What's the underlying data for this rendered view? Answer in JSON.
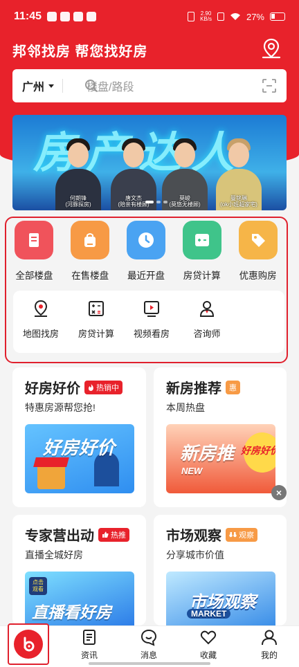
{
  "status_bar": {
    "time": "11:45",
    "net_speed_top": "2.90",
    "net_speed_unit": "KB/s",
    "battery": "27%"
  },
  "header": {
    "title": "邦邻找房 帮您找好房",
    "location_icon": "location-pin-icon"
  },
  "search": {
    "city": "广州",
    "placeholder": "楼盘/路段"
  },
  "banner": {
    "title": "房产达人",
    "people": [
      {
        "name": "何朗锋",
        "desc": "(河豚探房)"
      },
      {
        "name": "唐文杰",
        "desc": "(陪亲有楼顾)"
      },
      {
        "name": "莫峻",
        "desc": "(莫悠无楼顾)"
      },
      {
        "name": "曼铭琳",
        "desc": "(ok小班超家宅)"
      }
    ]
  },
  "categories": [
    {
      "label": "全部楼盘",
      "icon": "building-icon",
      "color": "#f0535b"
    },
    {
      "label": "在售楼盘",
      "icon": "bag-icon",
      "color": "#f79a45"
    },
    {
      "label": "最近开盘",
      "icon": "clock-icon",
      "color": "#4aa3f2"
    },
    {
      "label": "房贷计算",
      "icon": "calculator-icon",
      "color": "#3fc48a"
    },
    {
      "label": "优惠购房",
      "icon": "coupon-tag-icon",
      "color": "#f6b548"
    }
  ],
  "tools": [
    {
      "label": "地图找房",
      "icon": "map-pin-icon"
    },
    {
      "label": "房贷计算",
      "icon": "calculator-icon"
    },
    {
      "label": "视频看房",
      "icon": "video-icon"
    },
    {
      "label": "咨询师",
      "icon": "consultant-icon"
    }
  ],
  "cards": [
    {
      "title": "好房好价",
      "tag": "热销中",
      "tag_color": "#e8222b",
      "subtitle": "特惠房源帮您抢!",
      "image_text": "好房好价"
    },
    {
      "title": "新房推荐",
      "tag": "惠",
      "tag_color": "#f79a45",
      "subtitle": "本周热盘",
      "image_text": "新房推",
      "image_text_2": "好房好价",
      "image_text_3": "NEW"
    },
    {
      "title": "专家营出动",
      "tag": "热推",
      "tag_color": "#e8222b",
      "subtitle": "直播全城好房",
      "image_text": "直播看好房",
      "image_badge": "点击 观看"
    },
    {
      "title": "市场观察",
      "tag": "观察",
      "tag_color": "#f79a45",
      "subtitle": "分享城市价值",
      "image_text": "市场观察",
      "image_text_2": "MARKET"
    }
  ],
  "tabbar": {
    "home_icon": "home-b-logo-icon",
    "items": [
      {
        "label": "资讯",
        "icon": "news-icon"
      },
      {
        "label": "消息",
        "icon": "message-icon"
      },
      {
        "label": "收藏",
        "icon": "heart-icon"
      },
      {
        "label": "我的",
        "icon": "profile-icon"
      }
    ]
  }
}
